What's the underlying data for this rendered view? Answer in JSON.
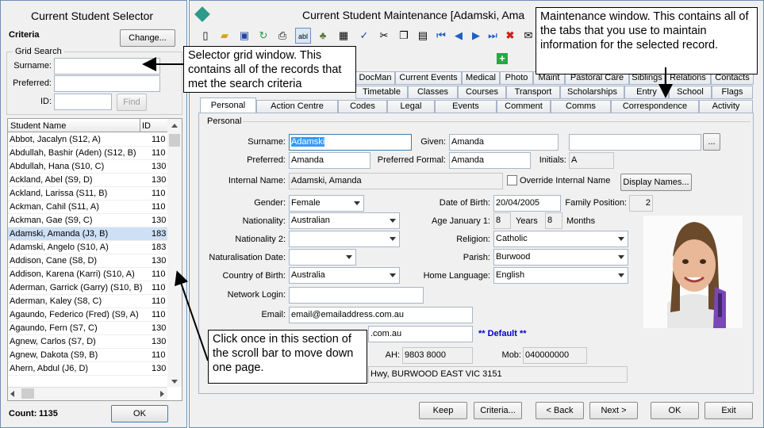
{
  "selector": {
    "title": "Current Student Selector",
    "criteria_label": "Criteria",
    "change_button": "Change...",
    "grid_search_label": "Grid Search",
    "surname_label": "Surname:",
    "preferred_label": "Preferred:",
    "id_label": "ID:",
    "find_button": "Find",
    "col_name": "Student Name",
    "col_id": "ID",
    "rows": [
      {
        "name": "Abbot, Jacalyn (S12, A)",
        "id": "110"
      },
      {
        "name": "Abdullah, Bashir (Aden) (S12, B)",
        "id": "110"
      },
      {
        "name": "Abdullah, Hana (S10, C)",
        "id": "130"
      },
      {
        "name": "Ackland, Abel (S9, D)",
        "id": "130"
      },
      {
        "name": "Ackland, Larissa (S11, B)",
        "id": "110"
      },
      {
        "name": "Ackman, Cahil (S11, A)",
        "id": "110"
      },
      {
        "name": "Ackman, Gae (S9, C)",
        "id": "130"
      },
      {
        "name": "Adamski, Amanda (J3, B)",
        "id": "183"
      },
      {
        "name": "Adamski, Angelo (S10, A)",
        "id": "183"
      },
      {
        "name": "Addison, Cane (S8, D)",
        "id": "130"
      },
      {
        "name": "Addison, Karena (Karri) (S10, A)",
        "id": "110"
      },
      {
        "name": "Aderman, Garrick (Garry) (S10, B)",
        "id": "110"
      },
      {
        "name": "Aderman, Kaley (S8, C)",
        "id": "110"
      },
      {
        "name": "Agaundo, Federico (Fred) (S9, A)",
        "id": "110"
      },
      {
        "name": "Agaundo, Fern (S7, C)",
        "id": "130"
      },
      {
        "name": "Agnew, Carlos (S7, D)",
        "id": "130"
      },
      {
        "name": "Agnew, Dakota (S9, B)",
        "id": "110"
      },
      {
        "name": "Ahern, Abdul (J6, D)",
        "id": "130"
      }
    ],
    "count_label": "Count:",
    "count_value": "1135",
    "ok_button": "OK"
  },
  "main": {
    "title": "Current Student Maintenance  [Adamski, Ama",
    "tabs_row1": [
      "DocMan",
      "Current Events",
      "Medical",
      "Photo",
      "Maint",
      "Pastoral Care",
      "Siblings",
      "Relations",
      "Contacts"
    ],
    "tabs_row2": [
      "Timetable",
      "Classes",
      "Courses",
      "Transport",
      "Scholarships",
      "Entry",
      "School",
      "Flags"
    ],
    "tabs_row3": [
      "Personal",
      "Action Centre",
      "Codes",
      "Legal",
      "Events",
      "Comment",
      "Comms",
      "Correspondence",
      "Activity"
    ],
    "section_label": "Personal",
    "fields": {
      "surname_label": "Surname:",
      "surname": "Adamski",
      "given_label": "Given:",
      "given": "Amanda",
      "preferred_label": "Preferred:",
      "preferred": "Amanda",
      "preferred_formal_label": "Preferred Formal:",
      "preferred_formal": "Amanda",
      "initials_label": "Initials:",
      "initials": "A",
      "internal_name_label": "Internal Name:",
      "internal_name": "Adamski, Amanda",
      "override_label": "Override Internal Name",
      "display_names_button": "Display Names...",
      "gender_label": "Gender:",
      "gender": "Female",
      "dob_label": "Date of Birth:",
      "dob": "20/04/2005",
      "family_position_label": "Family Position:",
      "family_position": "2",
      "nationality_label": "Nationality:",
      "nationality": "Australian",
      "age_label": "Age January 1:",
      "age_years": "8",
      "years_label": "Years",
      "age_months": "8",
      "months_label": "Months",
      "nationality2_label": "Nationality 2:",
      "religion_label": "Religion:",
      "religion": "Catholic",
      "naturalisation_label": "Naturalisation Date:",
      "parish_label": "Parish:",
      "parish": "Burwood",
      "country_label": "Country of Birth:",
      "country": "Australia",
      "home_language_label": "Home Language:",
      "home_language": "English",
      "network_login_label": "Network Login:",
      "email_label": "Email:",
      "email": "email@emailaddress.com.au",
      "email2": ".com.au",
      "default_label": "** Default **",
      "ah_label": "AH:",
      "ah": "9803 8000",
      "mob_label": "Mob:",
      "mob": "040000000",
      "address": "Hwy, BURWOOD EAST VIC 3151",
      "ellipsis_button": "..."
    },
    "buttons": {
      "keep": "Keep",
      "criteria": "Criteria...",
      "back": "< Back",
      "next": "Next >",
      "ok": "OK",
      "exit": "Exit"
    }
  },
  "callouts": {
    "selector": "Selector grid window. This contains all of the records that met the search criteria",
    "maintenance": "Maintenance window. This contains all of the tabs that you use to maintain information for the selected record.",
    "scroll": "Click once in this section of the scroll bar to move down one page."
  },
  "colors": {
    "accent": "#0000cc",
    "border": "#6e8fb5",
    "selected_row": "#cde0f5",
    "add_icon": "#22aa44"
  }
}
